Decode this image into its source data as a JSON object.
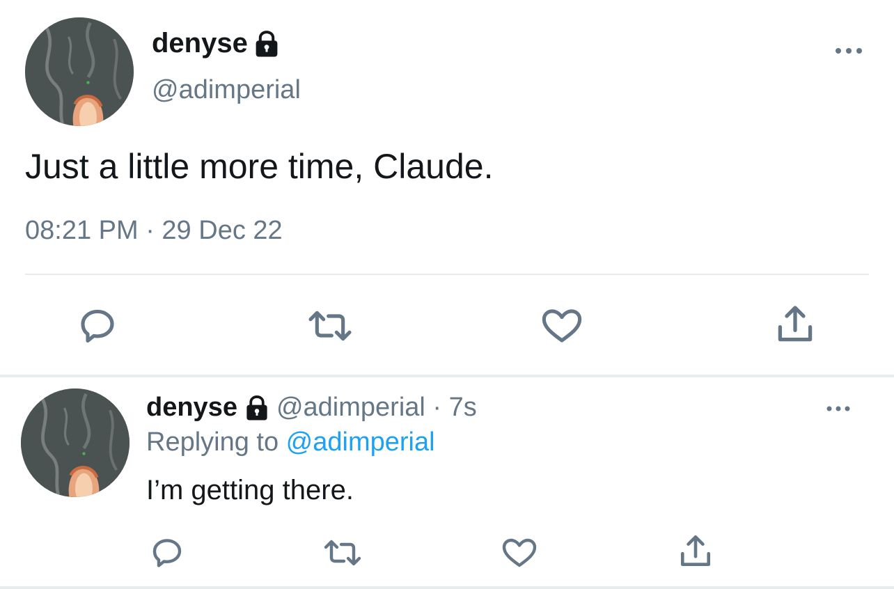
{
  "main_tweet": {
    "display_name": "denyse",
    "handle": "@adimperial",
    "lock_icon": "lock-icon",
    "more_icon": "more-horizontal-icon",
    "text": "Just a little more time, Claude.",
    "timestamp": "08:21 PM · 29 Dec 22",
    "actions": {
      "reply_icon": "reply-icon",
      "retweet_icon": "retweet-icon",
      "like_icon": "heart-icon",
      "share_icon": "share-icon"
    }
  },
  "reply_tweet": {
    "display_name": "denyse",
    "handle_time": "@adimperial · 7s",
    "lock_icon": "lock-icon",
    "more_icon": "more-horizontal-icon",
    "replying_prefix": "Replying to ",
    "replying_to": "@adimperial",
    "text": "I’m getting there.",
    "actions": {
      "reply_icon": "reply-icon",
      "retweet_icon": "retweet-icon",
      "like_icon": "heart-icon",
      "share_icon": "share-icon"
    }
  },
  "colors": {
    "text_primary": "#14171a",
    "text_secondary": "#657786",
    "link": "#1da1f2",
    "divider": "#e6ecf0"
  }
}
